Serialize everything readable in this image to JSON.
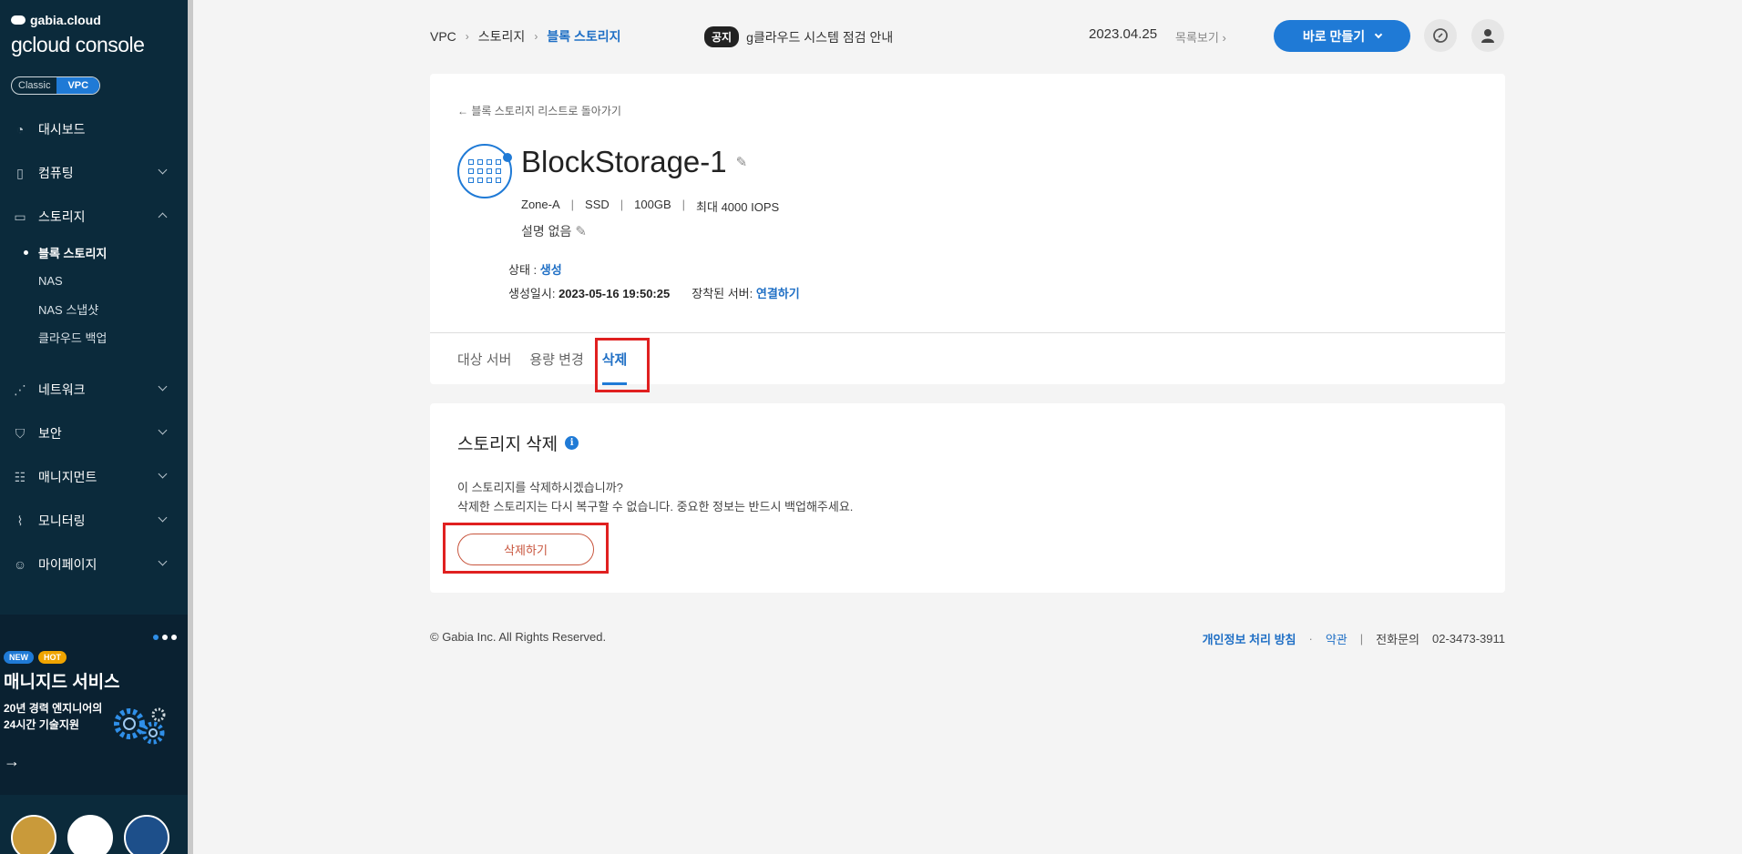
{
  "sidebar": {
    "brand_top": "gabia.cloud",
    "brand_main": "gcloud console",
    "toggle": {
      "classic": "Classic",
      "vpc": "VPC"
    },
    "items": [
      {
        "label": "대시보드",
        "icon": "dashboard-icon"
      },
      {
        "label": "컴퓨팅",
        "icon": "chip-icon"
      },
      {
        "label": "스토리지",
        "icon": "storage-icon"
      },
      {
        "label": "네트워크",
        "icon": "network-icon"
      },
      {
        "label": "보안",
        "icon": "shield-icon"
      },
      {
        "label": "매니지먼트",
        "icon": "management-icon"
      },
      {
        "label": "모니터링",
        "icon": "monitoring-icon"
      },
      {
        "label": "마이페이지",
        "icon": "user-icon"
      }
    ],
    "storage_sub": [
      "블록 스토리지",
      "NAS",
      "NAS 스냅샷",
      "클라우드 백업"
    ],
    "promo": {
      "badge_new": "NEW",
      "badge_hot": "HOT",
      "title": "매니지드 서비스",
      "line1": "20년 경력 엔지니어의",
      "line2": "24시간 기술지원",
      "arrow": "→"
    }
  },
  "header": {
    "breadcrumb": [
      "VPC",
      "스토리지",
      "블록 스토리지"
    ],
    "breadcrumb_sep": "›",
    "notice_badge": "공지",
    "notice_text": "g클라우드 시스템 점검 안내",
    "date": "2023.04.25",
    "list_link": "목록보기 ›",
    "create_button": "바로 만들기"
  },
  "detail": {
    "back_link": "← 블록 스토리지 리스트로 돌아가기",
    "name": "BlockStorage-1",
    "specs": [
      "Zone-A",
      "SSD",
      "100GB",
      "최대 4000 IOPS"
    ],
    "spec_sep": "|",
    "description": "설명 없음",
    "status_label": "상태 : ",
    "status_value": "생성",
    "created_label": "생성일시: ",
    "created_value": "2023-05-16 19:50:25",
    "attached_label": "장착된 서버: ",
    "attached_value": "연결하기",
    "tabs": [
      "대상 서버",
      "용량 변경",
      "삭제"
    ]
  },
  "delete_section": {
    "title": "스토리지 삭제",
    "info": "i",
    "line1": "이 스토리지를 삭제하시겠습니까?",
    "line2": "삭제한 스토리지는 다시 복구할 수 없습니다. 중요한 정보는 반드시 백업해주세요.",
    "button": "삭제하기"
  },
  "footer": {
    "copyright": "© Gabia Inc. All Rights Reserved.",
    "privacy": "개인정보 처리 방침",
    "dot": "·",
    "terms": "약관",
    "bar": "|",
    "phone_label": "전화문의",
    "phone": "02-3473-3911"
  },
  "colors": {
    "accent": "#1f7ad6",
    "sidebar_bg": "#0b2a3b",
    "highlight": "#e02020",
    "danger": "#c8553d"
  }
}
